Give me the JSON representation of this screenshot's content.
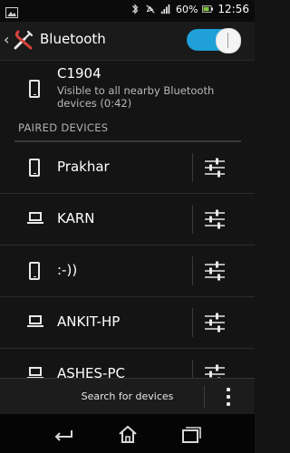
{
  "status_bar": {
    "battery_percent": "60%",
    "time": "12:56"
  },
  "action_bar": {
    "title": "Bluetooth",
    "toggle_on": true
  },
  "this_device": {
    "name": "C1904",
    "visibility": "Visible to all nearby Bluetooth devices (0:42)"
  },
  "paired": {
    "header": "PAIRED DEVICES",
    "devices": [
      {
        "name": "Prakhar",
        "type": "phone"
      },
      {
        "name": "KARN",
        "type": "laptop"
      },
      {
        "name": ":-))",
        "type": "phone"
      },
      {
        "name": "ANKIT-HP",
        "type": "laptop"
      },
      {
        "name": "ASHES-PC",
        "type": "laptop"
      }
    ]
  },
  "bottom_bar": {
    "search_label": "Search for devices"
  }
}
